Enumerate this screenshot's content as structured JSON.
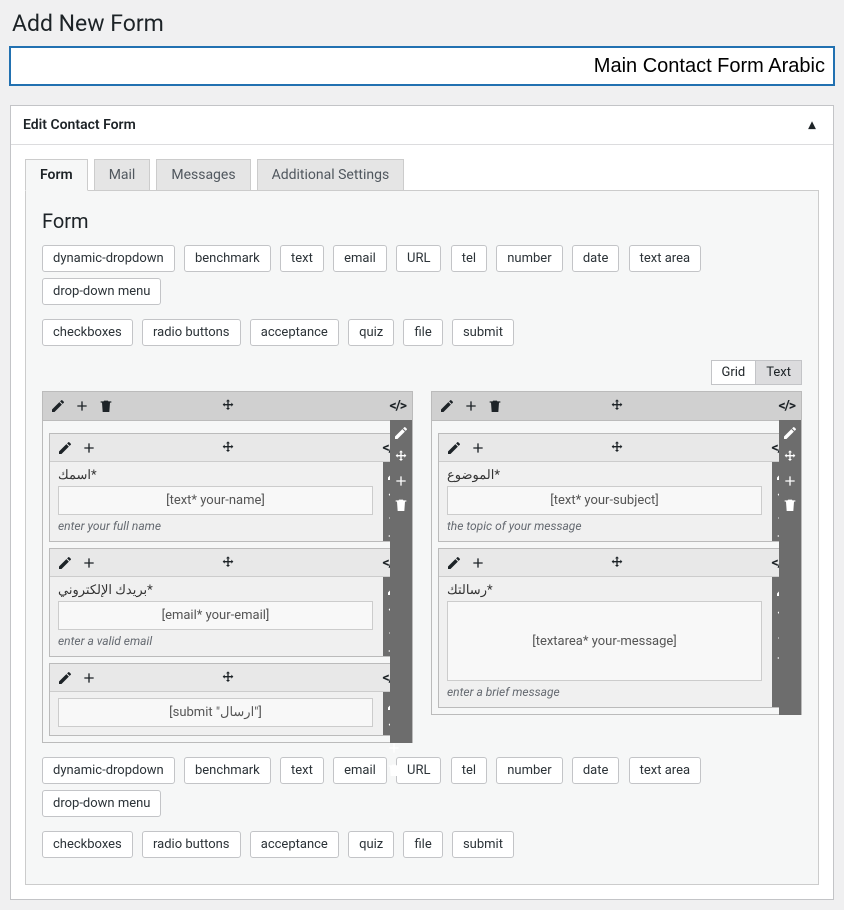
{
  "page_title": "Add New Form",
  "form_title_value": "Main Contact Form Arabic",
  "panel_heading": "Edit Contact Form",
  "tabs": [
    "Form",
    "Mail",
    "Messages",
    "Additional Settings"
  ],
  "section_heading": "Form",
  "tag_buttons_row1": [
    "dynamic-dropdown",
    "benchmark",
    "text",
    "email",
    "URL",
    "tel",
    "number",
    "date",
    "text area",
    "drop-down menu"
  ],
  "tag_buttons_row2": [
    "checkboxes",
    "radio buttons",
    "acceptance",
    "quiz",
    "file",
    "submit"
  ],
  "view_modes": {
    "grid": "Grid",
    "text": "Text"
  },
  "columns": [
    {
      "fields": [
        {
          "label": "اسمك*",
          "placeholder": "[text* your-name]",
          "desc": "enter your full name",
          "tall": false
        },
        {
          "label": "بريدك الإلكتروني*",
          "placeholder": "[email* your-email]",
          "desc": "enter a valid email",
          "tall": false
        },
        {
          "label": "",
          "placeholder": "[submit \"ارسال\"]",
          "desc": "",
          "tall": false
        }
      ]
    },
    {
      "fields": [
        {
          "label": "الموضوع*",
          "placeholder": "[text* your-subject]",
          "desc": "the topic of your message",
          "tall": false
        },
        {
          "label": "رسالتك*",
          "placeholder": "[textarea* your-message]",
          "desc": "enter a brief message",
          "tall": true
        }
      ]
    }
  ]
}
